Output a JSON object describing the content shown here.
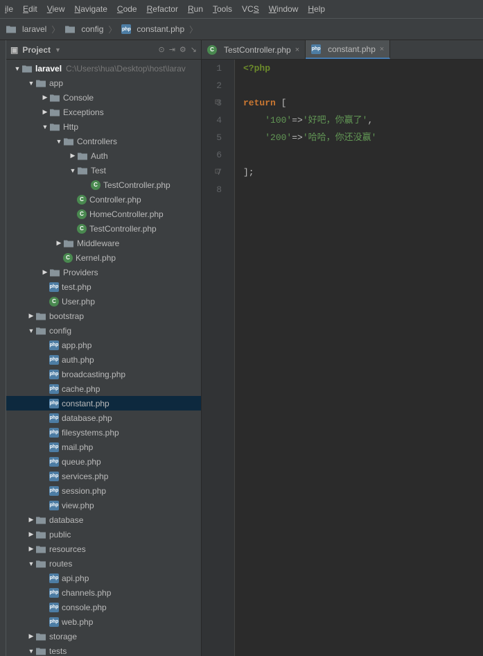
{
  "menu": [
    "ile",
    "Edit",
    "View",
    "Navigate",
    "Code",
    "Refactor",
    "Run",
    "Tools",
    "VCS",
    "Window",
    "Help"
  ],
  "menu_underline_idx": [
    0,
    0,
    0,
    0,
    0,
    0,
    0,
    0,
    2,
    0,
    0
  ],
  "breadcrumb": [
    {
      "icon": "folder-project",
      "label": "laravel"
    },
    {
      "icon": "folder",
      "label": "config"
    },
    {
      "icon": "php",
      "label": "constant.php"
    }
  ],
  "project_label": "Project",
  "root_hint": "C:\\Users\\hua\\Desktop\\host\\larav",
  "tree": [
    {
      "indent": 0,
      "arrow": "expanded",
      "icon": "folder-project",
      "label": "laravel",
      "bold": true,
      "hint": true
    },
    {
      "indent": 1,
      "arrow": "expanded",
      "icon": "folder",
      "label": "app"
    },
    {
      "indent": 2,
      "arrow": "collapsed",
      "icon": "folder",
      "label": "Console"
    },
    {
      "indent": 2,
      "arrow": "collapsed",
      "icon": "folder",
      "label": "Exceptions"
    },
    {
      "indent": 2,
      "arrow": "expanded",
      "icon": "folder",
      "label": "Http"
    },
    {
      "indent": 3,
      "arrow": "expanded",
      "icon": "folder",
      "label": "Controllers"
    },
    {
      "indent": 4,
      "arrow": "collapsed",
      "icon": "folder",
      "label": "Auth"
    },
    {
      "indent": 4,
      "arrow": "expanded",
      "icon": "folder",
      "label": "Test"
    },
    {
      "indent": 5,
      "arrow": "none",
      "icon": "class",
      "label": "TestController.php"
    },
    {
      "indent": 4,
      "arrow": "none",
      "icon": "class",
      "label": "Controller.php"
    },
    {
      "indent": 4,
      "arrow": "none",
      "icon": "class",
      "label": "HomeController.php"
    },
    {
      "indent": 4,
      "arrow": "none",
      "icon": "class",
      "label": "TestController.php"
    },
    {
      "indent": 3,
      "arrow": "collapsed",
      "icon": "folder",
      "label": "Middleware"
    },
    {
      "indent": 3,
      "arrow": "none",
      "icon": "class",
      "label": "Kernel.php"
    },
    {
      "indent": 2,
      "arrow": "collapsed",
      "icon": "folder",
      "label": "Providers"
    },
    {
      "indent": 2,
      "arrow": "none",
      "icon": "php",
      "label": "test.php"
    },
    {
      "indent": 2,
      "arrow": "none",
      "icon": "class",
      "label": "User.php"
    },
    {
      "indent": 1,
      "arrow": "collapsed",
      "icon": "folder",
      "label": "bootstrap"
    },
    {
      "indent": 1,
      "arrow": "expanded",
      "icon": "folder",
      "label": "config"
    },
    {
      "indent": 2,
      "arrow": "none",
      "icon": "php",
      "label": "app.php"
    },
    {
      "indent": 2,
      "arrow": "none",
      "icon": "php",
      "label": "auth.php"
    },
    {
      "indent": 2,
      "arrow": "none",
      "icon": "php",
      "label": "broadcasting.php"
    },
    {
      "indent": 2,
      "arrow": "none",
      "icon": "php",
      "label": "cache.php"
    },
    {
      "indent": 2,
      "arrow": "none",
      "icon": "php",
      "label": "constant.php",
      "selected": true
    },
    {
      "indent": 2,
      "arrow": "none",
      "icon": "php",
      "label": "database.php"
    },
    {
      "indent": 2,
      "arrow": "none",
      "icon": "php",
      "label": "filesystems.php"
    },
    {
      "indent": 2,
      "arrow": "none",
      "icon": "php",
      "label": "mail.php"
    },
    {
      "indent": 2,
      "arrow": "none",
      "icon": "php",
      "label": "queue.php"
    },
    {
      "indent": 2,
      "arrow": "none",
      "icon": "php",
      "label": "services.php"
    },
    {
      "indent": 2,
      "arrow": "none",
      "icon": "php",
      "label": "session.php"
    },
    {
      "indent": 2,
      "arrow": "none",
      "icon": "php",
      "label": "view.php"
    },
    {
      "indent": 1,
      "arrow": "collapsed",
      "icon": "folder",
      "label": "database"
    },
    {
      "indent": 1,
      "arrow": "collapsed",
      "icon": "folder",
      "label": "public"
    },
    {
      "indent": 1,
      "arrow": "collapsed",
      "icon": "folder",
      "label": "resources"
    },
    {
      "indent": 1,
      "arrow": "expanded",
      "icon": "folder",
      "label": "routes"
    },
    {
      "indent": 2,
      "arrow": "none",
      "icon": "php",
      "label": "api.php"
    },
    {
      "indent": 2,
      "arrow": "none",
      "icon": "php",
      "label": "channels.php"
    },
    {
      "indent": 2,
      "arrow": "none",
      "icon": "php",
      "label": "console.php"
    },
    {
      "indent": 2,
      "arrow": "none",
      "icon": "php",
      "label": "web.php"
    },
    {
      "indent": 1,
      "arrow": "collapsed",
      "icon": "folder",
      "label": "storage"
    },
    {
      "indent": 1,
      "arrow": "expanded",
      "icon": "folder",
      "label": "tests"
    }
  ],
  "tabs": [
    {
      "icon": "class",
      "label": "TestController.php",
      "active": false
    },
    {
      "icon": "php",
      "label": "constant.php",
      "active": true
    }
  ],
  "code": {
    "lines": 8,
    "l1_phptag": "<?php",
    "l3_return": "return",
    "l3_open": " [",
    "l4_key": "'100'",
    "l4_arrow": "=>",
    "l4_val": "'好吧，你赢了'",
    "l4_comma": ",",
    "l5_key": "'200'",
    "l5_arrow": "=>",
    "l5_val": "'哈哈，你还没赢'",
    "l7_close": "];"
  }
}
